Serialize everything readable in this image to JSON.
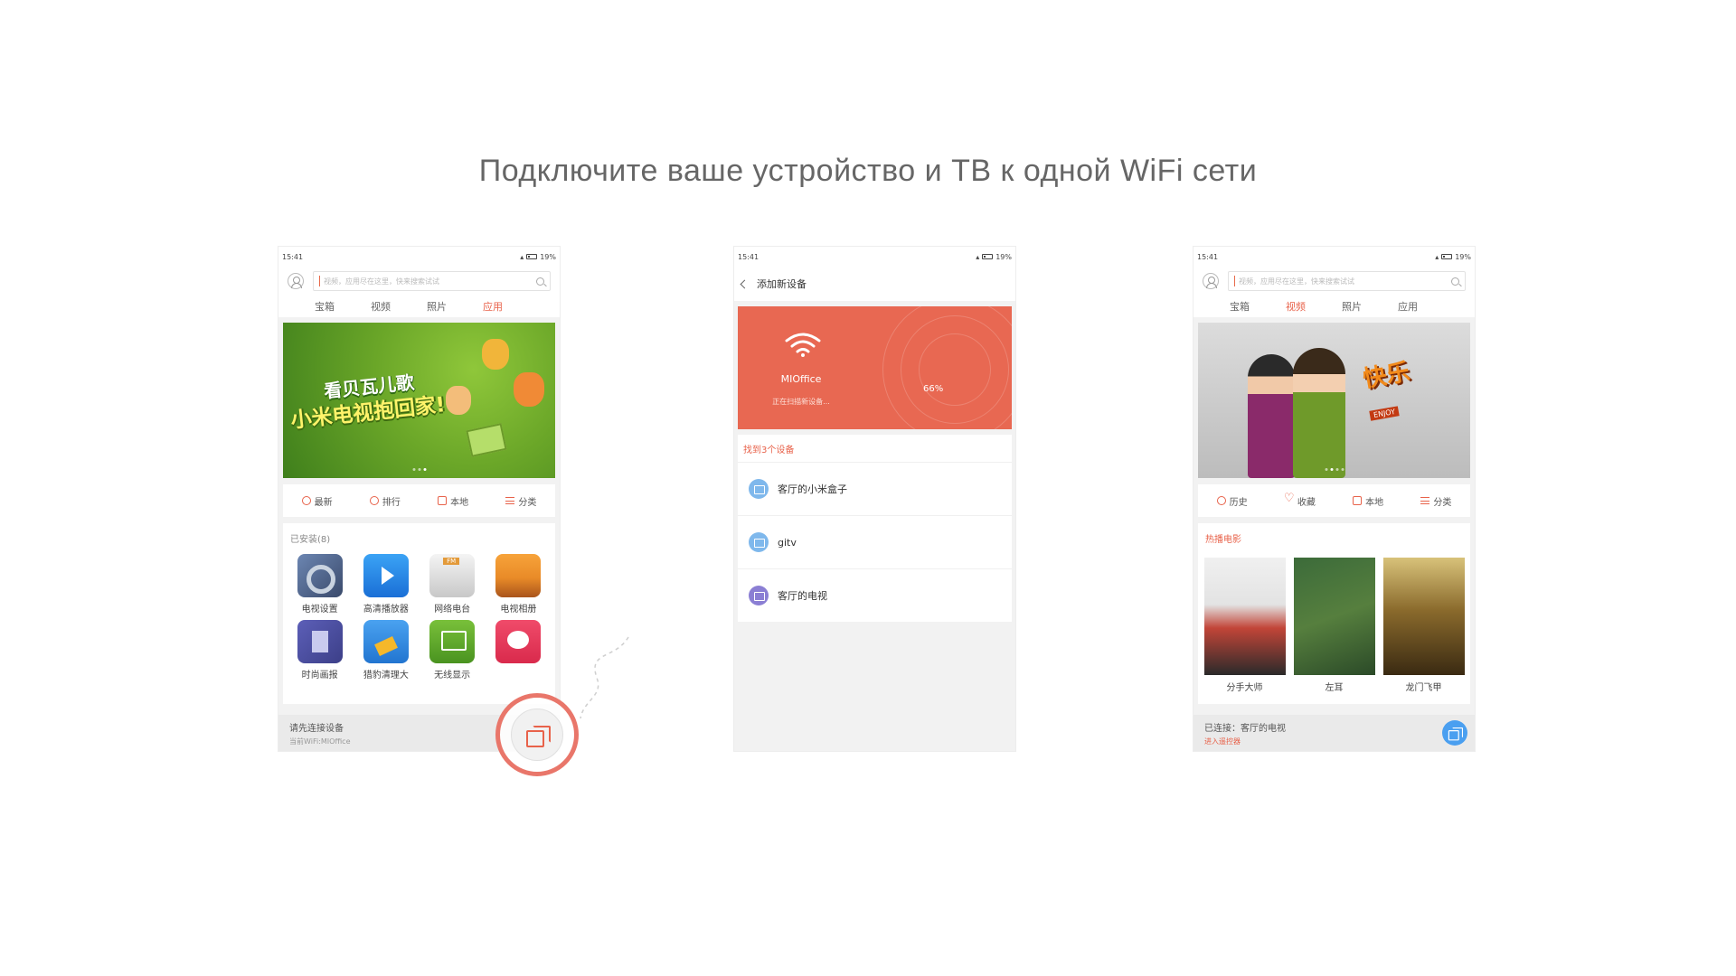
{
  "header": {
    "subtitle": "Подключите ваше устройство и ТВ к одной WiFi сети"
  },
  "status": {
    "time": "15:41",
    "battery": "19%"
  },
  "phone1": {
    "search_placeholder": "视频，应用尽在这里，快来搜索试试",
    "tabs": [
      "宝箱",
      "视频",
      "照片",
      "应用"
    ],
    "active_tab": "应用",
    "banner": {
      "line1": "看贝瓦儿歌",
      "line2": "小米电视抱回家!"
    },
    "quick": [
      "最新",
      "排行",
      "本地",
      "分类"
    ],
    "installed_title": "已安装(8)",
    "apps": [
      "电视设置",
      "高清播放器",
      "网络电台",
      "电视相册",
      "时尚画报",
      "猎豹清理大",
      "无线显示",
      ""
    ],
    "bottom": {
      "main": "请先连接设备",
      "sub": "当前WiFi:MIOffice"
    }
  },
  "phone2": {
    "nav_title": "添加新设备",
    "ssid": "MIOffice",
    "scan_status": "正在扫描新设备...",
    "progress": "66%",
    "found_title": "找到3个设备",
    "devices": [
      "客厅的小米盒子",
      "gitv",
      "客厅的电视"
    ]
  },
  "phone3": {
    "search_placeholder": "视频，应用尽在这里，快来搜索试试",
    "tabs": [
      "宝箱",
      "视频",
      "照片",
      "应用"
    ],
    "active_tab": "视频",
    "quick": [
      "历史",
      "收藏",
      "本地",
      "分类"
    ],
    "hot_title": "热播电影",
    "movies": [
      "分手大师",
      "左耳",
      "龙门飞甲"
    ],
    "bottom": {
      "main": "已连接：客厅的电视",
      "sub": "进入遥控器"
    }
  },
  "colors": {
    "accent": "#e8624a",
    "scan_panel": "#e86852",
    "connected": "#4a9ff0"
  }
}
